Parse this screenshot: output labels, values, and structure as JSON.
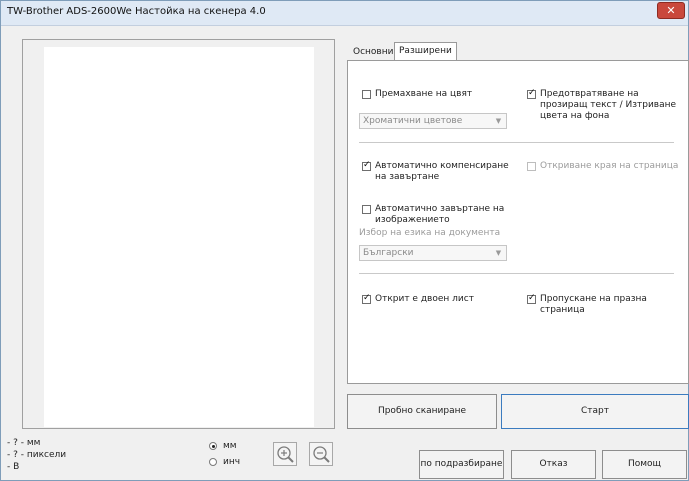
{
  "window": {
    "title": "TW-Brother ADS-2600We Настойка на скенера 4.0",
    "close_label": "✕"
  },
  "info": {
    "line1": "- ? - мм",
    "line2": "- ? - пиксели",
    "line3": "- B"
  },
  "units": {
    "mm_label": "мм",
    "inch_label": "инч",
    "selected": "мм"
  },
  "zoom": {
    "in_icon": "zoom-in-icon",
    "out_icon": "zoom-out-icon"
  },
  "tabs": [
    {
      "label": "Основни",
      "active": false
    },
    {
      "label": "Разширени",
      "active": true
    }
  ],
  "options": {
    "remove_color": {
      "label": "Премахване на цвят",
      "checked": false
    },
    "color_combo": {
      "value": "Хроматични цветове"
    },
    "bleed_through": {
      "label": "Предотвратяване на прозиращ текст / Изтриване цвета на фона",
      "checked": true
    },
    "auto_deskew": {
      "label": "Автоматично компенсиране на завъртане",
      "checked": true
    },
    "edge_detect": {
      "label": "Откриване края на страница",
      "checked": false
    },
    "auto_rotate": {
      "label": "Автоматично завъртане на изображението",
      "checked": false
    },
    "language_caption": "Избор на езика на документа",
    "language_combo": {
      "value": "Български"
    },
    "double_feed": {
      "label": "Открит е двоен лист",
      "checked": true
    },
    "skip_blank": {
      "label": "Пропускане на празна страница",
      "checked": true
    }
  },
  "buttons": {
    "trial_scan": "Пробно сканиране",
    "start": "Старт",
    "default": "по подразбиране",
    "cancel": "Отказ",
    "help": "Помощ"
  }
}
